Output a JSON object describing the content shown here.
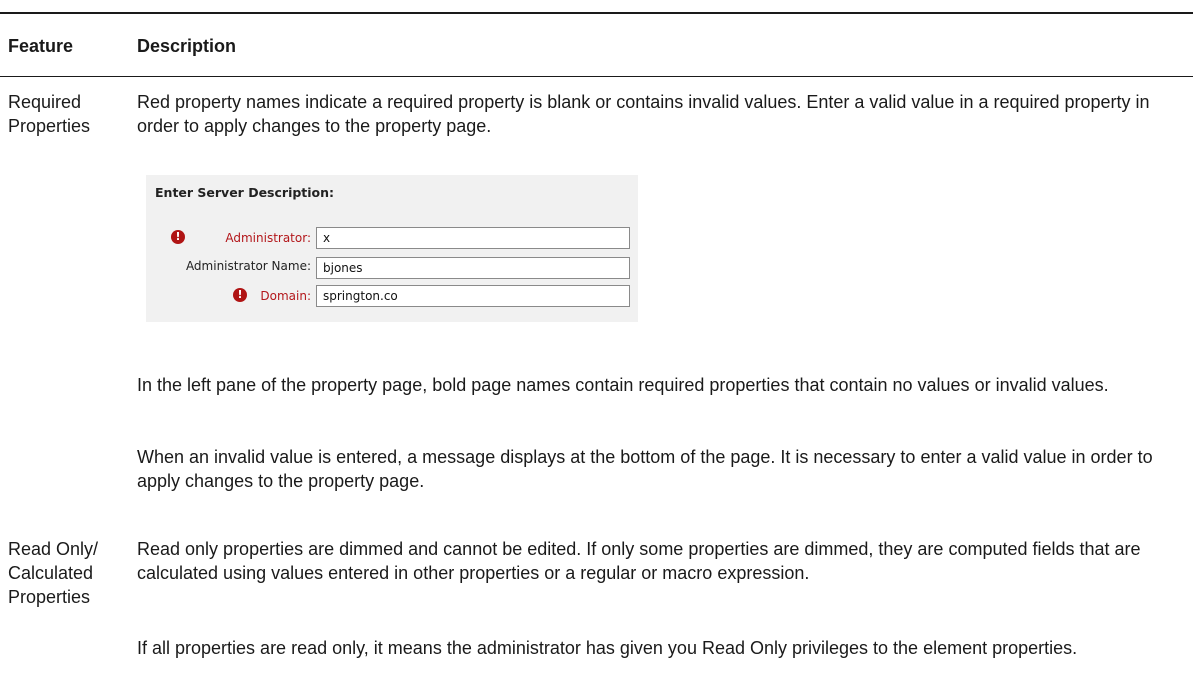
{
  "table": {
    "headers": {
      "feature": "Feature",
      "description": "Description"
    },
    "rows": [
      {
        "feature": "Required Properties",
        "paragraphs": [
          "Red property names indicate a required property is blank or contains invalid values. Enter a valid value in a required property in order to apply changes to the property page.",
          "In the left pane of the property page, bold page names contain required properties that contain no values or invalid values.",
          "When an invalid value is entered, a message displays at the bottom of the page. It is necessary to enter a valid value in order to apply changes to the property page."
        ]
      },
      {
        "feature": "Read Only/ Calculated Properties",
        "paragraphs": [
          "Read only properties are dimmed and cannot be edited. If only some properties are dimmed, they are computed fields that are calculated using values entered in other properties or a regular or macro expression.",
          "If all properties are read only, it means the administrator has given you Read Only privileges to the element properties."
        ]
      }
    ]
  },
  "example_form": {
    "title": "Enter Server Description:",
    "fields": [
      {
        "label": "Administrator:",
        "value": "x",
        "required": true
      },
      {
        "label": "Administrator Name:",
        "value": "bjones",
        "required": false
      },
      {
        "label": "Domain:",
        "value": "springton.co",
        "required": true
      }
    ],
    "required_icon_glyph": "!",
    "colors": {
      "required_label": "#b3171b",
      "required_icon": "#b01414",
      "panel_bg": "#f1f1f1"
    }
  }
}
